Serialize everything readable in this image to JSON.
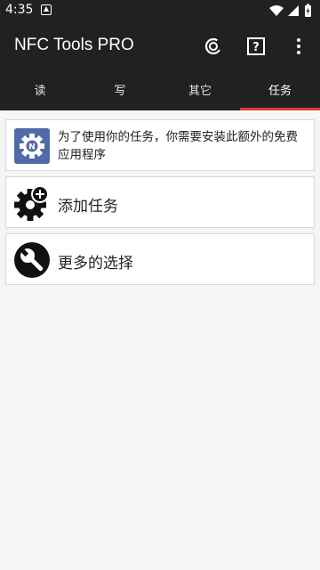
{
  "status": {
    "time": "4:35"
  },
  "appbar": {
    "title": "NFC Tools PRO",
    "icons": [
      "sync-icon",
      "help-icon",
      "more-vert-icon"
    ]
  },
  "tabs": [
    {
      "label": "读",
      "active": false
    },
    {
      "label": "写",
      "active": false
    },
    {
      "label": "其它",
      "active": false
    },
    {
      "label": "任务",
      "active": true
    }
  ],
  "colors": {
    "appbar": "#212121",
    "accent": "#e53935",
    "background": "#f5f5f5",
    "info_icon": "#4f6ba8"
  },
  "cards": {
    "info": {
      "text": "为了使用你的任务，你需要安装此额外的免费应用程序",
      "icon": "nfc-tasks-app-icon"
    },
    "add": {
      "label": "添加任务",
      "icon": "add-gear-icon"
    },
    "more": {
      "label": "更多的选择",
      "icon": "wrench-icon"
    }
  }
}
